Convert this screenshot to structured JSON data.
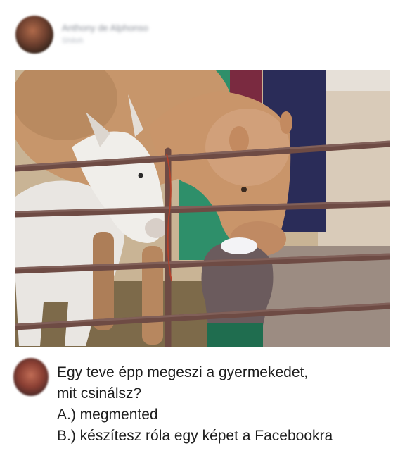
{
  "post": {
    "author_name": "Anthony de Alphonso",
    "author_meta": "Shiloh",
    "avatar_icon": "profile-photo",
    "image_icon": "camel-eating-child-photo"
  },
  "comment": {
    "avatar_icon": "profile-photo",
    "lines": [
      "Egy teve épp megeszi a gyermekedet,",
      "mit csinálsz?",
      "A.) megmented",
      "B.) készítesz róla egy képet a Facebookra"
    ]
  }
}
